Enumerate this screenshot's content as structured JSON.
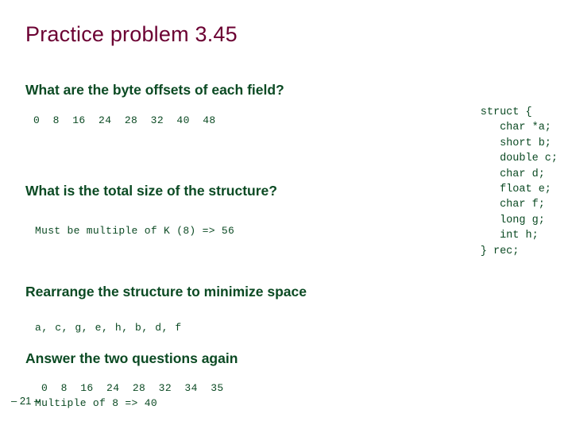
{
  "slide": {
    "title": "Practice problem 3.45",
    "page_number": "– 21 –",
    "sections": {
      "offsets_heading": "What are the byte offsets of each field?",
      "offsets_values": "0  8  16  24  28  32  40  48",
      "total_size_heading": "What is the total size of the structure?",
      "total_size_answer": "Must be multiple of K (8) => 56",
      "rearrange_heading": "Rearrange the structure to minimize space",
      "rearrange_answer": "a, c, g, e, h, b, d, f",
      "again_heading": "Answer the two questions again",
      "again_offsets": "0  8  16  24  28  32  34  35",
      "again_total": "Multiple of 8 => 40"
    },
    "code": "struct {\n   char *a;\n   short b;\n   double c;\n   char d;\n   float e;\n   char f;\n   long g;\n   int h;\n} rec;"
  },
  "colors": {
    "title": "#6b0032",
    "body": "#0b4a23",
    "background": "#ffffff"
  }
}
